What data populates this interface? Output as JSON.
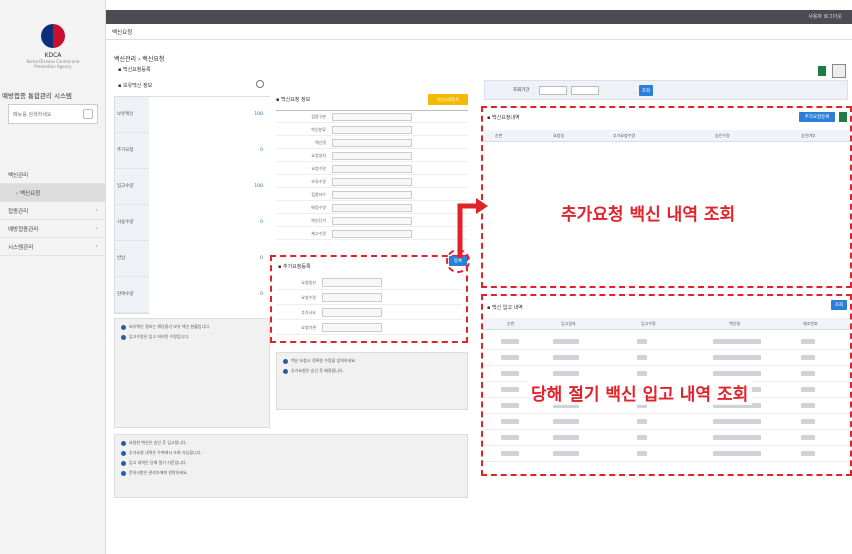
{
  "brand": {
    "org_abbr": "KDCA",
    "org_name_en": "Korea Disease Control and Prevention Agency",
    "system_title": "예방접종 통합관리 시스템"
  },
  "sidebar": {
    "search_placeholder": "메뉴를 검색하세요",
    "menu_items": [
      {
        "label": "백신관리",
        "selected": false
      },
      {
        "label": "› 백신요청",
        "selected": true
      },
      {
        "label": "접종관리",
        "selected": false
      },
      {
        "label": "예방접종관리",
        "selected": false
      },
      {
        "label": "시스템관리",
        "selected": false
      }
    ]
  },
  "topbar": {
    "user_info": "사용자 로그아웃"
  },
  "breadcrumb": "백신요청",
  "page": {
    "title": "백신관리 › 백신요청",
    "section": "백신요청등록"
  },
  "left_panel": {
    "title": "보유백신 정보",
    "rows": [
      {
        "label": "보유백신",
        "value": "100"
      },
      {
        "label": "추가요청",
        "value": "0"
      },
      {
        "label": "입고수량",
        "value": "100"
      },
      {
        "label": "사용수량",
        "value": "0"
      },
      {
        "label": "반납",
        "value": "0"
      },
      {
        "label": "잔여수량",
        "value": "0"
      }
    ]
  },
  "middle_panel": {
    "title": "백신요청 정보",
    "badge": "백신요청등록",
    "fields": [
      "접종구분",
      "백신분류",
      "백신명",
      "요청일자",
      "요청수량",
      "보유수량",
      "접종자수",
      "배정수량",
      "백신단가",
      "재고수량"
    ]
  },
  "add_request": {
    "title": "추가요청등록",
    "button": "등록",
    "fields": [
      "요청일자",
      "요청수량",
      "추가사유",
      "요청기관"
    ]
  },
  "right_top": {
    "search_label": "조회기간",
    "search_button": "조회",
    "section_title": "백신요청내역",
    "register_button": "추가요청등록",
    "columns": [
      "순번",
      "요청일",
      "추가요청수량",
      "승인수량",
      "승인여부"
    ],
    "overlay_label": "추가요청 백신 내역 조회"
  },
  "right_bottom": {
    "section_title": "백신 입고 내역",
    "search_button": "조회",
    "columns": [
      "순번",
      "입고일자",
      "입고수량",
      "백신명",
      "제조번호"
    ],
    "row_count": 8,
    "overlay_label": "당해 절기 백신 입고 내역 조회"
  },
  "notes": {
    "left": [
      "보유백신 정보는 해당절기 보유 백신 현황입니다.",
      "입고수량은 입고 처리된 수량입니다."
    ],
    "middle": [
      "백신 요청시 정확한 수량을 입력하세요.",
      "추가요청은 승인 후 배정됩니다."
    ],
    "bottom": [
      "요청한 백신은 승인 후 입고됩니다.",
      "추가요청 내역은 우측에서 조회 가능합니다.",
      "입고 내역은 당해 절기 기준입니다.",
      "문의사항은 관리자에게 연락하세요."
    ]
  },
  "colors": {
    "accent": "#2b7fd9",
    "highlight": "#e0232b",
    "badge": "#f5b800"
  }
}
